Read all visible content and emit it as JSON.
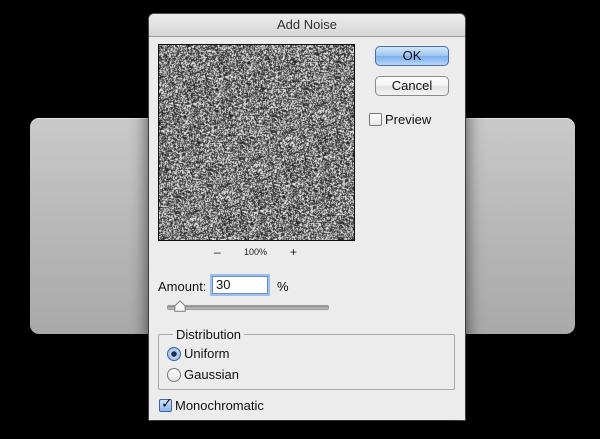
{
  "dialog": {
    "title": "Add Noise",
    "ok_label": "OK",
    "cancel_label": "Cancel",
    "preview_label": "Preview",
    "preview_checked": false
  },
  "zoom": {
    "minus": "–",
    "level": "100%",
    "plus": "+"
  },
  "amount": {
    "label": "Amount:",
    "value": "30",
    "unit": "%",
    "slider_fraction": 0.075
  },
  "distribution": {
    "legend": "Distribution",
    "options": [
      {
        "label": "Uniform",
        "selected": true
      },
      {
        "label": "Gaussian",
        "selected": false
      }
    ]
  },
  "monochromatic": {
    "label": "Monochromatic",
    "checked": true
  },
  "colors": {
    "dialog_bg": "#ececec",
    "ok_button": "#8db9ef",
    "focus_ring": "#9cc0ee",
    "backdrop": "#000000"
  },
  "icons": {
    "check": "check-icon",
    "slider_thumb": "triangle-thumb-icon"
  }
}
